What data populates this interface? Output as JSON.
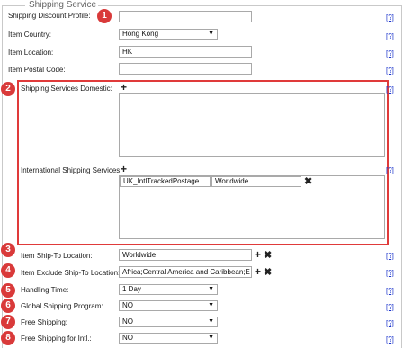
{
  "section": {
    "legend": "Shipping Service",
    "help_label": "[?]"
  },
  "fields": {
    "shipping_discount_profile": {
      "label": "Shipping Discount Profile:",
      "value": ""
    },
    "item_country": {
      "label": "Item Country:",
      "value": "Hong Kong"
    },
    "item_location": {
      "label": "Item Location:",
      "value": "HK"
    },
    "item_postal_code": {
      "label": "Item Postal Code:",
      "value": ""
    },
    "shipping_services_domestic": {
      "label": "Shipping Services Domestic:"
    },
    "international_shipping_services": {
      "label": "International Shipping Services:",
      "rows": [
        {
          "service": "UK_IntlTrackedPostage",
          "location": "Worldwide"
        }
      ]
    },
    "item_ship_to_location": {
      "label": "Item Ship-To Location:",
      "value": "Worldwide"
    },
    "item_exclude_ship_to_location": {
      "label": "Item Exclude Ship-To Location:",
      "value": "Africa;Central America and Caribbean;E"
    },
    "handling_time": {
      "label": "Handling Time:",
      "value": "1 Day"
    },
    "global_shipping_program": {
      "label": "Global Shipping Program:",
      "value": "NO"
    },
    "free_shipping": {
      "label": "Free Shipping:",
      "value": "NO"
    },
    "free_shipping_intl": {
      "label": "Free Shipping for Intl.:",
      "value": "NO"
    }
  },
  "badges": [
    "1",
    "2",
    "3",
    "4",
    "5",
    "6",
    "7",
    "8"
  ],
  "icons": {
    "add": "+",
    "remove": "✖",
    "dropdown": "▼"
  },
  "colors": {
    "badge": "#d93a3a",
    "highlight_border": "#e03a3a",
    "help_link": "#1a33cc"
  }
}
